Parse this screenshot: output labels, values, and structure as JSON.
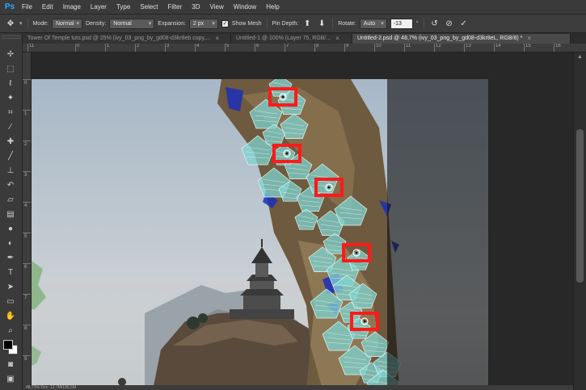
{
  "app": {
    "logo": "Ps"
  },
  "menu": [
    "File",
    "Edit",
    "Image",
    "Layer",
    "Type",
    "Select",
    "Filter",
    "3D",
    "View",
    "Window",
    "Help"
  ],
  "options": {
    "mode_label": "Mode:",
    "mode_value": "Normal",
    "density_label": "Density:",
    "density_value": "Normal",
    "expansion_label": "Expansion:",
    "expansion_value": "2 px",
    "show_mesh_label": "Show Mesh",
    "show_mesh_checked": true,
    "pin_depth_label": "Pin Depth:",
    "rotate_label": "Rotate:",
    "rotate_mode": "Auto",
    "rotate_value": "-13",
    "rotate_unit": "°"
  },
  "tabs": [
    {
      "label": "Tower Of Temple tuts.psd @ 25% (ivy_03_png_by_gd08-d3kr8eb copy,...",
      "active": false
    },
    {
      "label": "Untitled-1 @ 100% (Layer 75, RGB/...",
      "active": false
    },
    {
      "label": "Untitled-2.psd @ 48,7% (ivy_03_png_by_gd08-d3kr8eL, RGB/8) *",
      "active": true
    }
  ],
  "ruler_top": [
    "11",
    "0",
    "1",
    "2",
    "3",
    "4",
    "5",
    "6",
    "7",
    "8",
    "9",
    "10",
    "11",
    "12",
    "13",
    "14",
    "15",
    "16"
  ],
  "ruler_left": [
    "0",
    "1",
    "2",
    "3",
    "4",
    "5",
    "6",
    "7",
    "8",
    "9"
  ],
  "status": "48,73%   Doc: 12,7M/180,5M",
  "pins": [
    {
      "label": "pin-1"
    },
    {
      "label": "pin-2"
    },
    {
      "label": "pin-3"
    },
    {
      "label": "pin-4"
    },
    {
      "label": "pin-5"
    }
  ],
  "colors": {
    "pin_box": "#ff1a1a",
    "mesh": "#7fd4d0",
    "ps_logo": "#31a8ff"
  },
  "icons": {
    "tools": [
      "move-icon",
      "marquee-icon",
      "lasso-icon",
      "magic-wand-icon",
      "crop-icon",
      "eyedropper-icon",
      "healing-brush-icon",
      "brush-icon",
      "clone-stamp-icon",
      "history-brush-icon",
      "eraser-icon",
      "gradient-icon",
      "blur-icon",
      "dodge-icon",
      "pen-icon",
      "type-icon",
      "path-selection-icon",
      "shape-icon",
      "hand-icon",
      "zoom-icon"
    ]
  }
}
